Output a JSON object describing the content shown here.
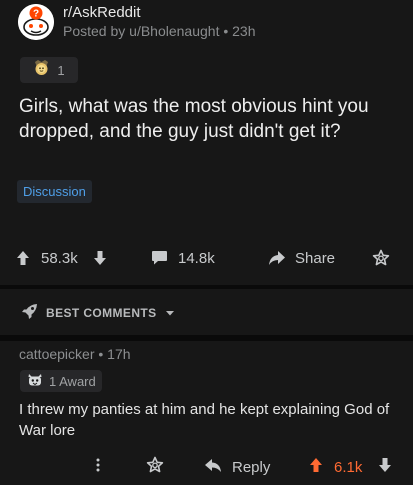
{
  "post": {
    "subreddit": "r/AskReddit",
    "posted_by": "Posted by u/Bholenaught • 23h",
    "award_count": "1",
    "title": "Girls, what was the most obvious hint you dropped, and the guy just didn't get it?",
    "flair": "Discussion",
    "upvotes": "58.3k",
    "comments": "14.8k",
    "share_label": "Share"
  },
  "sort": {
    "label": "BEST COMMENTS"
  },
  "comment": {
    "author_line": "cattoepicker • 17h",
    "award_label": "1 Award",
    "body": "I threw my panties at him and he kept explaining God of War lore",
    "reply_label": "Reply",
    "upvotes": "6.1k"
  },
  "colors": {
    "background": "#171717",
    "accent_blue": "#4f9fe8",
    "upvote_orange": "#ff6a33",
    "text": "#d7dadc",
    "muted": "#8a8c8e"
  },
  "icons": {
    "subreddit_avatar": "askreddit-snoo-icon",
    "award": "award-medal-icon",
    "upvote": "arrow-up-icon",
    "downvote": "arrow-down-icon",
    "comments": "comment-bubble-icon",
    "share": "share-arrow-icon",
    "give_award": "award-outline-icon",
    "sort": "rocket-icon",
    "more": "more-vertical-icon",
    "reply": "reply-arrow-icon"
  }
}
